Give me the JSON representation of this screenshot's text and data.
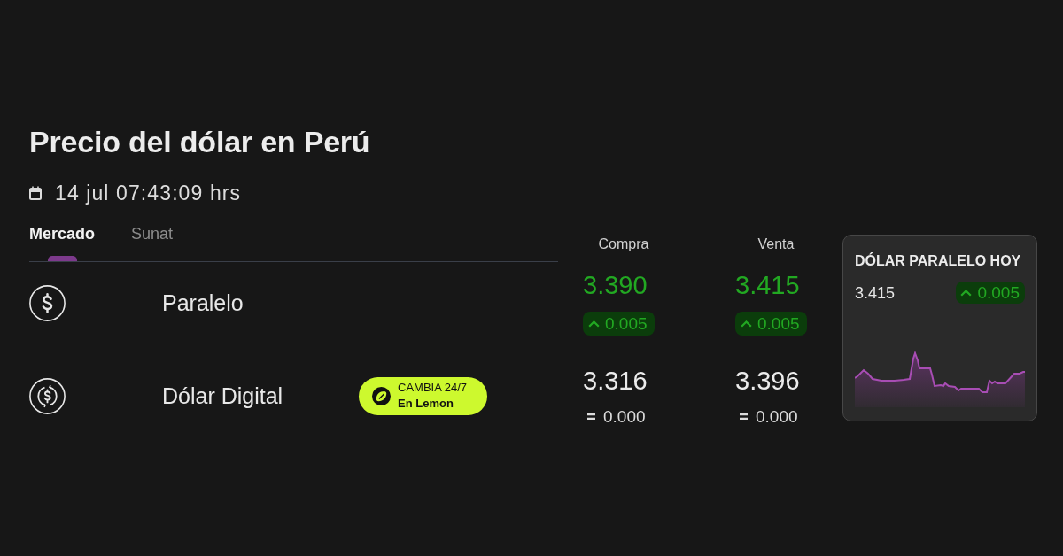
{
  "title": "Precio del dólar en Perú",
  "updated": "14 jul 07:43:09 hrs",
  "tabs": [
    {
      "label": "Mercado",
      "selected": true
    },
    {
      "label": "Sunat",
      "selected": false
    }
  ],
  "columns": [
    "Compra",
    "Venta"
  ],
  "rows": [
    {
      "kind": "cash",
      "name": "Paralelo",
      "quotes": [
        {
          "price": "3.390",
          "change": {
            "kind": "up",
            "value": "0.005"
          }
        },
        {
          "price": "3.415",
          "change": {
            "kind": "up",
            "value": "0.005"
          }
        }
      ]
    },
    {
      "kind": "digital",
      "name": "Dólar Digital",
      "promo": {
        "label": "CAMBIA 24/7",
        "sublabel": "En Lemon"
      },
      "quotes": [
        {
          "price": "3.316",
          "change": {
            "kind": "flat",
            "value": "0.000"
          }
        },
        {
          "price": "3.396",
          "change": {
            "kind": "flat",
            "value": "0.000"
          }
        }
      ]
    }
  ],
  "card": {
    "title": "DÓLAR PARALELO HOY",
    "price": "3.415",
    "change": {
      "kind": "up",
      "value": "0.005"
    }
  }
}
